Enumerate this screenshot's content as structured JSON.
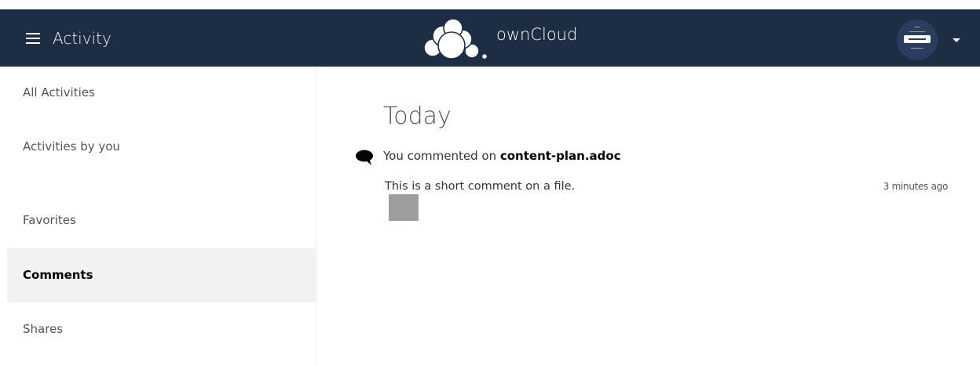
{
  "header": {
    "app_name": "Activity",
    "brand_name": "ownCloud",
    "colors": {
      "bar": "#1d2d44",
      "text": "#ffffff"
    },
    "icons": {
      "menu": "hamburger-icon",
      "logo": "cloud-logo",
      "caret": "caret-down-icon"
    }
  },
  "sidebar": {
    "items": [
      {
        "label": "All Activities",
        "active": false
      },
      {
        "label": "Activities by you",
        "active": false
      },
      {
        "label": "Favorites",
        "active": false
      },
      {
        "label": "Comments",
        "active": true
      },
      {
        "label": "Shares",
        "active": false
      }
    ]
  },
  "main": {
    "day_heading": "Today",
    "activities": [
      {
        "icon": "comment-icon",
        "subject_prefix": "You commented on ",
        "subject_file": "content-plan.adoc",
        "message": "This is a short comment on a file.",
        "time": "3 minutes ago"
      }
    ]
  }
}
